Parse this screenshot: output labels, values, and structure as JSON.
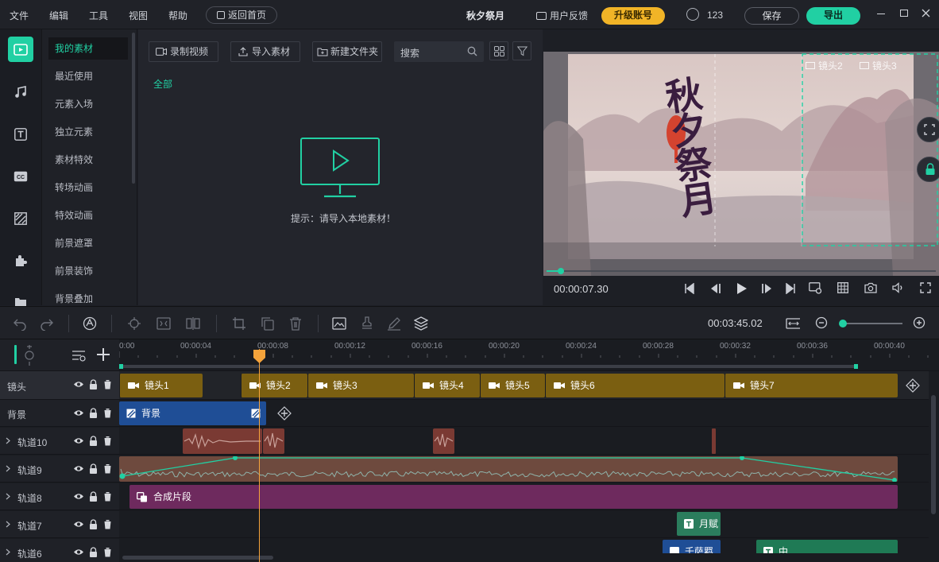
{
  "menu": {
    "items": [
      "文件",
      "编辑",
      "工具",
      "视图",
      "帮助"
    ],
    "home_button": "返回首页",
    "project_title": "秋夕祭月",
    "feedback": "用户反馈",
    "upgrade": "升级账号",
    "user_id": "123",
    "save": "保存",
    "export": "导出"
  },
  "categories": [
    "我的素材",
    "最近使用",
    "元素入场",
    "独立元素",
    "素材特效",
    "转场动画",
    "特效动画",
    "前景遮罩",
    "前景装饰",
    "背景叠加"
  ],
  "media": {
    "record_button": "录制视频",
    "import_button": "导入素材",
    "new_folder_button": "新建文件夹",
    "search_placeholder": "搜索",
    "filter_all": "全部",
    "empty_hint": "提示：请导入本地素材！"
  },
  "preview": {
    "time": "00:00:07.30",
    "poem_title": "秋夕祭月",
    "shot_labels": [
      "镜头2",
      "镜头3"
    ]
  },
  "toolbar": {
    "total_time": "00:03:45.02"
  },
  "ruler": [
    "0:00",
    "00:00:04",
    "00:00:08",
    "00:00:12",
    "00:00:16",
    "00:00:20",
    "00:00:24",
    "00:00:28",
    "00:00:32",
    "00:00:36",
    "00:00:40"
  ],
  "tracks": {
    "shot": "镜头",
    "background": "背景",
    "t10": "轨道10",
    "t9": "轨道9",
    "t8": "轨道8",
    "t7": "轨道7",
    "t6": "轨道6"
  },
  "clips": {
    "shots": [
      "镜头1",
      "镜头2",
      "镜头3",
      "镜头4",
      "镜头5",
      "镜头6",
      "镜头7"
    ],
    "background": "背景",
    "composite": "合成片段",
    "t7_text": "月赋",
    "t6_a": "千萨羁",
    "t6_b": "中"
  },
  "colors": {
    "accent": "#21d0a3",
    "upgrade": "#f1b427",
    "shot_clip": "#7b5f11",
    "bg_clip": "#1f4e96",
    "audio_clip": "#7a3a33",
    "composite_clip": "#6e2a5e",
    "text_clip": "#2b7d5d",
    "playhead": "#f5a33b"
  }
}
